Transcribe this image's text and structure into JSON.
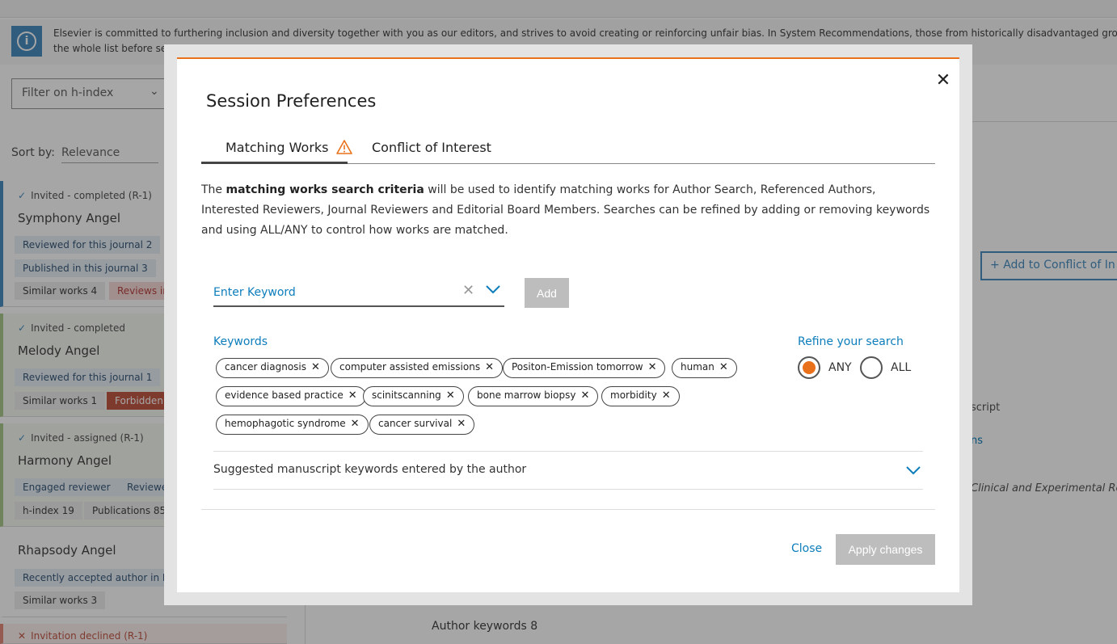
{
  "background": {
    "info_text_line1": "Elsevier is committed to furthering inclusion and diversity together with you as our editors, and strives to avoid creating or reinforcing unfair bias. In System Recommendations, those from historically disadvantaged groups may ap",
    "info_text_line2": "the whole list before se",
    "filter_placeholder": "Filter on h-index",
    "sort_label": "Sort by:",
    "sort_value": "Relevance",
    "cards": [
      {
        "status": "Invited - completed (R-1)",
        "name": "Symphony Angel",
        "chips": [
          "Reviewed for this journal 2",
          "Published in this journal 3",
          "Similar works 4",
          "Reviews in"
        ]
      },
      {
        "status": "Invited - completed",
        "name": "Melody Angel",
        "chips": [
          "Reviewed for this journal 1",
          "Similar works 1",
          "Forbidden"
        ]
      },
      {
        "status": "Invited - assigned (R-1)",
        "name": "Harmony Angel",
        "chips": [
          "Engaged reviewer",
          "Reviewe",
          "h-index 19",
          "Publications 85"
        ]
      },
      {
        "status": "",
        "name": "Rhapsody Angel",
        "chips": [
          "Recently accepted author in El",
          "Similar works 3"
        ]
      },
      {
        "status": "Invitation declined (R-1)",
        "name": "",
        "chips": []
      }
    ],
    "add_conflict_label": "Add to Conflict of In",
    "right_text_1": "script",
    "right_text_2": "ns",
    "right_text_3": "Clinical and Experimental Rese",
    "author_keywords": "Author keywords 8"
  },
  "modal": {
    "title": "Session Preferences",
    "tabs": [
      {
        "label": "Matching Works"
      },
      {
        "label": "Conflict of Interest"
      }
    ],
    "description_prefix": "The ",
    "description_bold": "matching works search criteria",
    "description_suffix": " will be used to identify matching works for Author Search, Referenced Authors, Interested Reviewers, Journal Reviewers and Editorial Board Members. Searches can be refined by adding or removing keywords and using ALL/ANY to control how works are matched.",
    "keyword_placeholder": "Enter Keyword",
    "add_label": "Add",
    "keywords_label": "Keywords",
    "keywords": [
      "cancer diagnosis",
      "computer assisted emissions",
      "Positon-Emission tomorrow",
      "human",
      "evidence based practice",
      "scinitscanning",
      "bone marrow biopsy",
      "morbidity",
      "hemophagotic syndrome",
      "cancer survival"
    ],
    "refine_label": "Refine your search",
    "refine_options": [
      "ANY",
      "ALL"
    ],
    "refine_selected": "ANY",
    "suggested_label": "Suggested manuscript keywords entered by the author",
    "close_label": "Close",
    "apply_label": "Apply changes",
    "accent_color": "#e9711c",
    "link_color": "#0c7dbb"
  }
}
